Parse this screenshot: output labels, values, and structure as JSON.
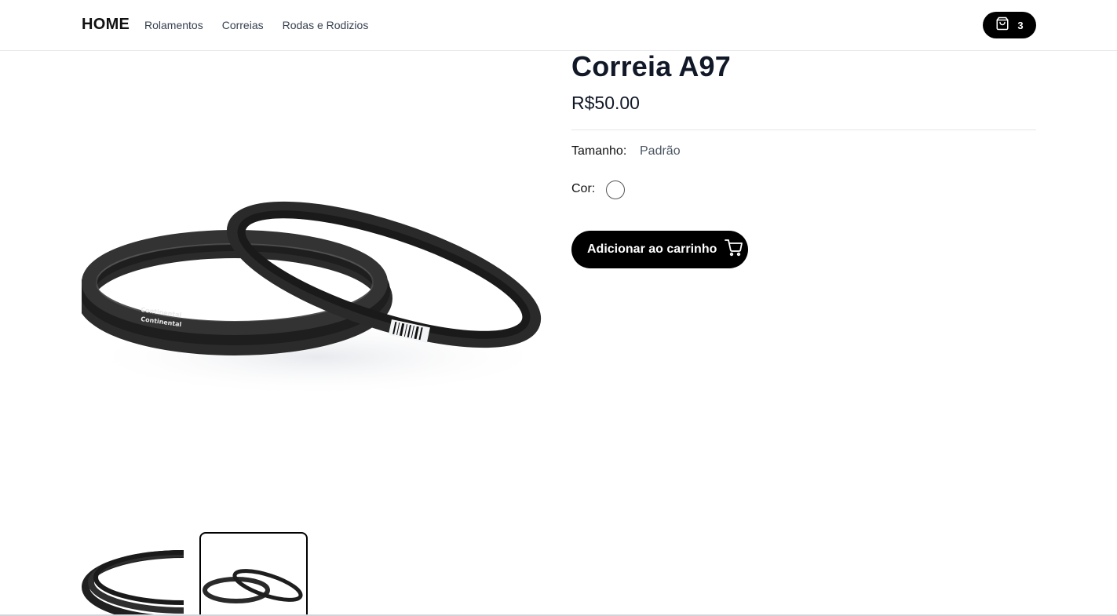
{
  "header": {
    "logo": "HOME",
    "nav": [
      "Rolamentos",
      "Correias",
      "Rodas e Rodizios"
    ],
    "cart_count": "3",
    "cart_icon": "shopping-bag-icon"
  },
  "product": {
    "title": "Correia A97",
    "price": "R$50.00",
    "size_label": "Tamanho:",
    "size_value": "Padrão",
    "color_label": "Cor:",
    "color_swatch": "#ffffff",
    "add_to_cart": "Adicionar ao carrinho",
    "add_icon": "cart-icon"
  },
  "gallery": {
    "image_alt": "Correias Continental",
    "thumbnails": 2,
    "selected_thumbnail": 2
  },
  "colors": {
    "primary": "#000000",
    "text": "#111827",
    "muted": "#4b5563",
    "border": "#e5e7eb"
  }
}
